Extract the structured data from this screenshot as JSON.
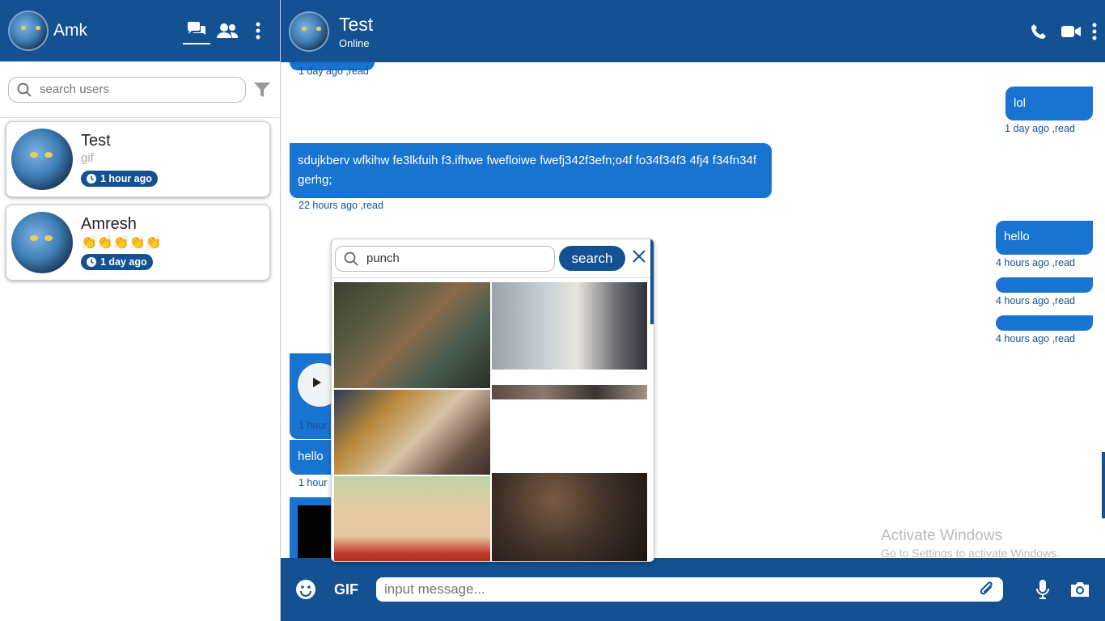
{
  "sidebar": {
    "user_name": "Amk",
    "search_placeholder": "search users",
    "contacts": [
      {
        "name": "Test",
        "preview": "gif",
        "time": "1 hour ago",
        "chat_label": "chat"
      },
      {
        "name": "Amresh",
        "preview": "👏👏👏👏👏",
        "time": "1 day ago",
        "chat_label": "chat"
      }
    ]
  },
  "chat": {
    "contact_name": "Test",
    "status": "Online",
    "messages": [
      {
        "side": "left",
        "text": "",
        "meta": "1 day ago ,read"
      },
      {
        "side": "right",
        "text": "lol",
        "meta": "1 day ago ,read"
      },
      {
        "side": "left",
        "text": "sdujkberv wfkihw fe3lkfuih f3.ifhwe fwefloiwe fwefj342f3efn;o4f fo34f34f3 4fj4 f34fn34f gerhg;",
        "meta": "22 hours ago ,read"
      },
      {
        "side": "right",
        "text": "hello",
        "meta": "4 hours ago ,read"
      },
      {
        "side": "right",
        "text": "",
        "meta": "4 hours ago ,read"
      },
      {
        "side": "right",
        "text": "",
        "meta": "4 hours ago ,read"
      },
      {
        "side": "left",
        "text": "",
        "meta": "1 hour"
      },
      {
        "side": "left",
        "text": "hello",
        "meta": "1 hour"
      }
    ],
    "input_placeholder": "input message...",
    "gif_label": "GIF"
  },
  "gif_picker": {
    "query": "punch",
    "search_label": "search",
    "results": [
      "gif-result",
      "gif-result",
      "gif-result",
      "gif-result",
      "gif-result",
      "gif-result",
      "gif-result"
    ]
  },
  "watermark": {
    "title": "Activate Windows",
    "subtitle": "Go to Settings to activate Windows."
  },
  "colors": {
    "primary": "#135193",
    "bubble": "#1973d1",
    "chat_badge": "#3b9a3d"
  }
}
